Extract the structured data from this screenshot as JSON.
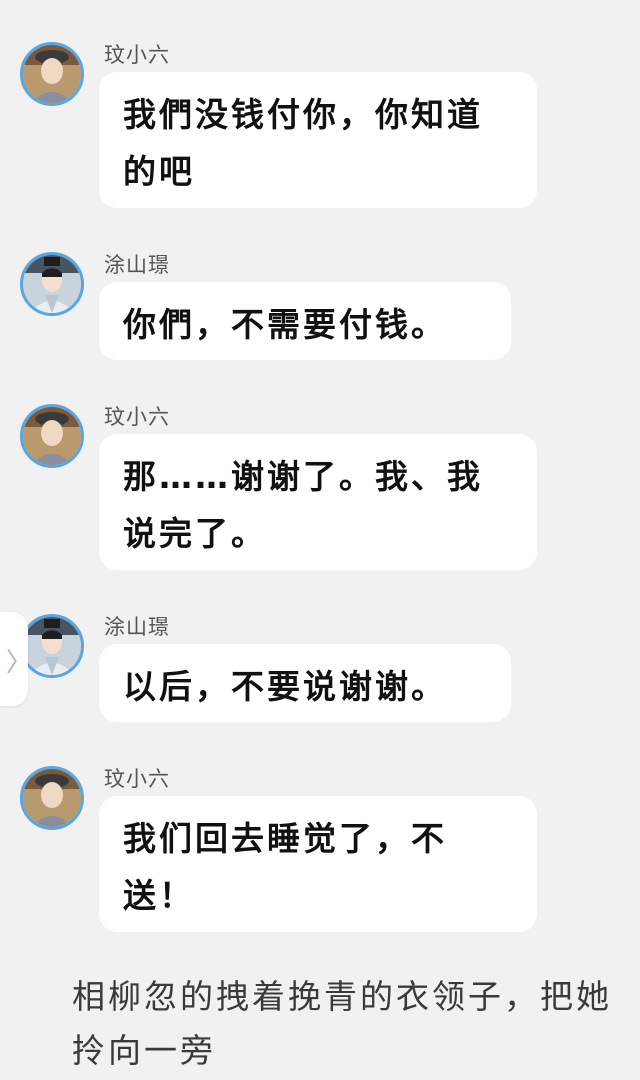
{
  "messages": [
    {
      "sender": "玟小六",
      "text": "我們没钱付你，你知道的吧",
      "avatar_icon": "woman-in-hat-avatar-icon"
    },
    {
      "sender": "涂山璟",
      "text": "你們，不需要付钱。",
      "avatar_icon": "man-in-white-robe-avatar-icon"
    },
    {
      "sender": "玟小六",
      "text": "那……谢谢了。我、我说完了。",
      "avatar_icon": "woman-in-hat-avatar-icon"
    },
    {
      "sender": "涂山璟",
      "text": "以后，不要说谢谢。",
      "avatar_icon": "man-in-white-robe-avatar-icon"
    },
    {
      "sender": "玟小六",
      "text": "我们回去睡觉了，不送！",
      "avatar_icon": "woman-in-hat-avatar-icon"
    }
  ],
  "side_tab": {
    "glyph": "〉"
  },
  "narration": "相柳忽的拽着挽青的衣领子，把她拎向一旁",
  "colors": {
    "background": "#f1f1f1",
    "bubble": "#ffffff",
    "avatar_ring": "#5aa6e3",
    "sender_text": "#555555",
    "message_text": "#111111"
  }
}
